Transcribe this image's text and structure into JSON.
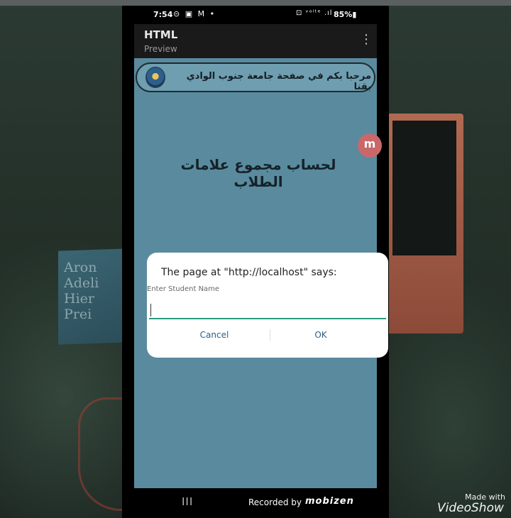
{
  "status_bar": {
    "time": "7:54",
    "left_icons": "⊝ ▣ M •",
    "right_icons": "⊡ ᵛᵒˡᵗᵉ .ıl",
    "battery": "85%▮"
  },
  "app_bar": {
    "title": "HTML",
    "subtitle": "Preview",
    "menu_icon": "⋮"
  },
  "page": {
    "banner_text": "مرحبا بكم في صفحة جامعة جنوب الوادي بقنا",
    "heading": "لحساب مجموع علامات الطلاب",
    "floating_badge": "m"
  },
  "dialog": {
    "title": "The page at \"http://localhost\" says:",
    "prompt_label": "Enter Student Name",
    "input_value": "",
    "cancel_label": "Cancel",
    "ok_label": "OK"
  },
  "nav_bar": {
    "recent_icon": "III",
    "recorded_by": "Recorded by",
    "recorder_brand": "mobizen"
  },
  "watermark": {
    "made_with": "Made with",
    "brand": "VideoShow"
  },
  "background": {
    "book_title": "Aron\nAdeli\nHier\nPrei"
  },
  "colors": {
    "webview_bg": "#5a8a9e",
    "dialog_button": "#2a5f8a",
    "input_underline": "#2a9a82"
  }
}
